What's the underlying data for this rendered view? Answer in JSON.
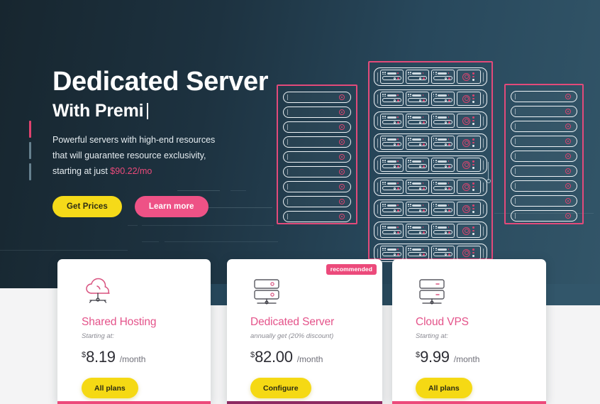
{
  "hero": {
    "heading_line1": "Dedicated Server",
    "heading_line2": "With Premi",
    "paragraph_line1": "Powerful servers with high-end resources",
    "paragraph_line2": "that will guarantee resource exclusivity,",
    "paragraph_line3_prefix": "starting at just ",
    "paragraph_price": "$90.22/mo",
    "cta_primary": "Get Prices",
    "cta_secondary": "Learn more",
    "colors": {
      "bg_dark": "#17262f",
      "bg_light": "#325568",
      "accent_pink": "#ec4a7b",
      "accent_yellow": "#f5da19",
      "rack_outline": "#e34a7a",
      "server_line": "#eef3f6"
    }
  },
  "illustration": {
    "rack_left_name": "server-rack-left",
    "rack_center_name": "server-rack-center",
    "rack_right_name": "server-rack-right",
    "rack_left_slots": 9,
    "rack_right_slots": 9,
    "rack_center_units": 9
  },
  "cards": [
    {
      "icon": "cloud-hosting-icon",
      "title": "Shared Hosting",
      "subtitle": "Starting at:",
      "currency": "$",
      "amount": "8.19",
      "period": "/month",
      "button": "All plans",
      "badge": null,
      "underline_color": "#ec4a7b"
    },
    {
      "icon": "dedicated-server-icon",
      "title": "Dedicated Server",
      "subtitle": "annually get (20% discount)",
      "currency": "$",
      "amount": "82.00",
      "period": "/month",
      "button": "Configure",
      "badge": "recommended",
      "underline_color": "#8d2a62"
    },
    {
      "icon": "cloud-vps-icon",
      "title": "Cloud VPS",
      "subtitle": "Starting at:",
      "currency": "$",
      "amount": "9.99",
      "period": "/month",
      "button": "All plans",
      "badge": null,
      "underline_color": "#ec4a7b"
    }
  ]
}
